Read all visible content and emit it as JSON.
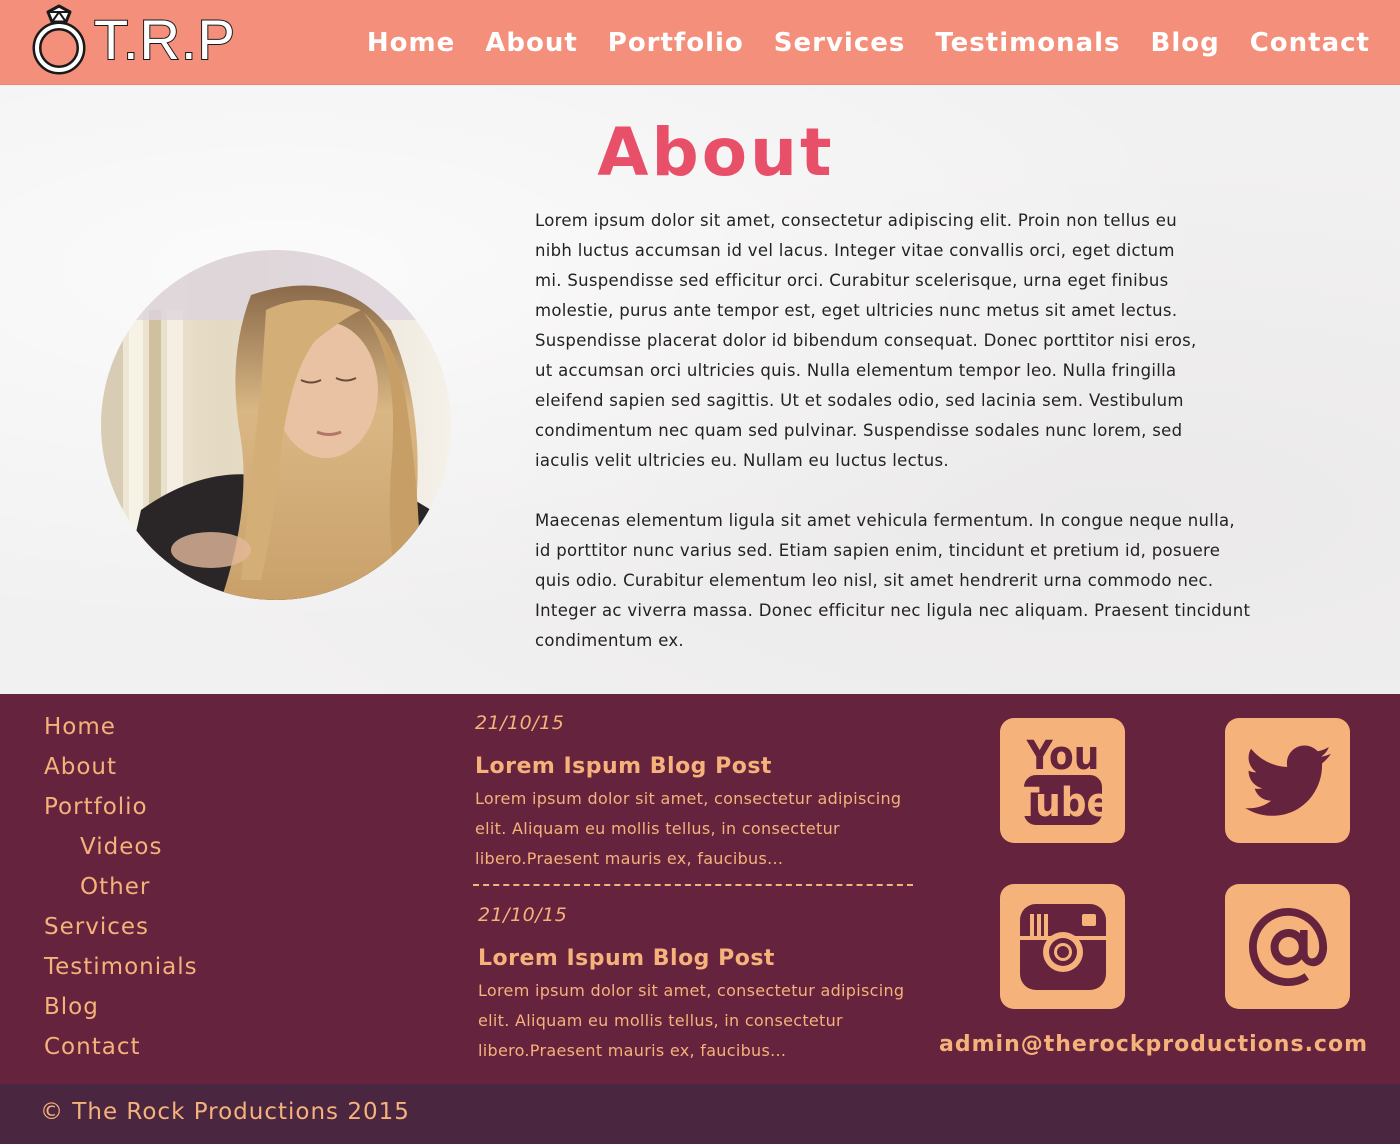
{
  "header": {
    "logo_text": "T.R.P",
    "nav": [
      "Home",
      "About",
      "Portfolio",
      "Services",
      "Testimonals",
      "Blog",
      "Contact"
    ]
  },
  "about": {
    "title": "About",
    "paragraph1": "Lorem ipsum dolor sit amet, consectetur adipiscing elit. Proin non tellus eu nibh luctus accumsan id vel lacus. Integer vitae convallis orci, eget dictum mi. Suspendisse sed efficitur orci. Curabitur scelerisque, urna eget finibus molestie, purus ante tempor est, eget ultricies nunc metus sit amet lectus. Suspendisse placerat dolor id bibendum consequat. Donec porttitor nisi eros, ut accumsan orci ultricies quis. Nulla elementum tempor leo. Nulla fringilla eleifend sapien sed sagittis. Ut et sodales odio, sed lacinia sem. Vestibulum condimentum nec quam sed pulvinar. Suspendisse sodales nunc lorem, sed iaculis velit ultricies eu. Nullam eu luctus lectus.",
    "paragraph2": "Maecenas elementum ligula sit amet vehicula fermentum. In congue neque nulla, id porttitor nunc varius sed. Etiam sapien enim, tincidunt et pretium id, posuere quis odio. Curabitur elementum leo nisl, sit amet hendrerit urna commodo nec. Integer ac viverra massa. Donec efficitur nec ligula nec aliquam. Praesent tincidunt condimentum ex."
  },
  "footer": {
    "nav": [
      "Home",
      "About",
      "Portfolio",
      "Videos",
      "Other",
      "Services",
      "Testimonials",
      "Blog",
      "Contact"
    ],
    "posts": [
      {
        "date": "21/10/15",
        "title": "Lorem Ispum Blog Post",
        "body": "Lorem ipsum dolor sit amet, consectetur adipiscing elit. Aliquam eu mollis tellus, in consectetur libero.Praesent mauris ex, faucibus..."
      },
      {
        "date": "21/10/15",
        "title": "Lorem Ispum Blog Post",
        "body": "Lorem ipsum dolor sit amet, consectetur adipiscing elit. Aliquam eu mollis tellus, in consectetur libero.Praesent mauris ex, faucibus..."
      }
    ],
    "social": {
      "youtube_line1": "You",
      "youtube_line2": "Tube",
      "icons": [
        "youtube-icon",
        "twitter-icon",
        "instagram-icon",
        "email-at-icon"
      ]
    },
    "email": "admin@therockproductions.com",
    "copyright": "© The Rock Productions 2015"
  },
  "colors": {
    "header_bg": "#f48f7b",
    "title": "#e8506a",
    "footer_bg": "#66233d",
    "footer_text": "#f5b27a",
    "bottom_bar": "#4a2640"
  }
}
